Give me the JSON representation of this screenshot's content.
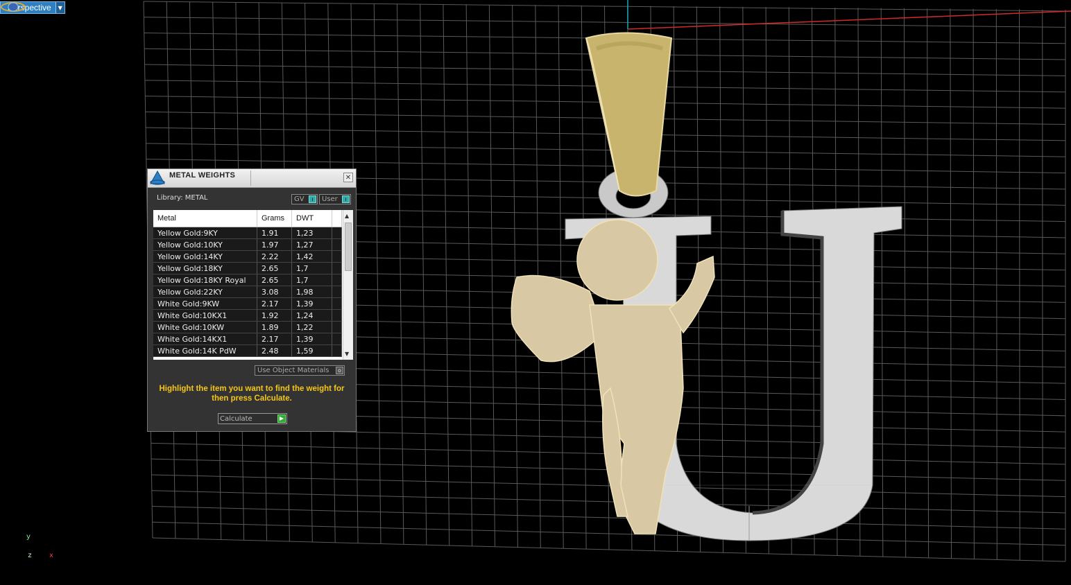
{
  "viewport": {
    "view_name": "Perspective",
    "axis_y": "y",
    "axis_z": "z",
    "axis_x": "x"
  },
  "panel": {
    "title": "METAL WEIGHTS",
    "library_label": "Library: METAL",
    "toggle_gv": "GV",
    "toggle_user": "User",
    "columns": [
      "Metal",
      "Grams",
      "DWT"
    ],
    "rows": [
      {
        "metal": "Yellow Gold:9KY",
        "grams": "1.91",
        "dwt": "1,23"
      },
      {
        "metal": "Yellow Gold:10KY",
        "grams": "1.97",
        "dwt": "1,27"
      },
      {
        "metal": "Yellow Gold:14KY",
        "grams": "2.22",
        "dwt": "1,42"
      },
      {
        "metal": "Yellow Gold:18KY",
        "grams": "2.65",
        "dwt": "1,7"
      },
      {
        "metal": "Yellow Gold:18KY Royal",
        "grams": "2.65",
        "dwt": "1,7"
      },
      {
        "metal": "Yellow Gold:22KY",
        "grams": "3.08",
        "dwt": "1,98"
      },
      {
        "metal": "White Gold:9KW",
        "grams": "2.17",
        "dwt": "1,39"
      },
      {
        "metal": "White Gold:10KX1",
        "grams": "1.92",
        "dwt": "1,24"
      },
      {
        "metal": "White Gold:10KW",
        "grams": "1.89",
        "dwt": "1,22"
      },
      {
        "metal": "White Gold:14KX1",
        "grams": "2.17",
        "dwt": "1,39"
      },
      {
        "metal": "White Gold:14K PdW",
        "grams": "2.48",
        "dwt": "1,59"
      }
    ],
    "use_object_materials": "Use Object Materials",
    "hint": "Highlight the item you want to find the weight for then press Calculate.",
    "calculate_label": "Calculate"
  },
  "colors": {
    "view_label_bg": "#2d7fc1",
    "hint_text": "#f5c518",
    "grid_line": "#5a5a5a",
    "gold_bail": "#c9b46e",
    "angel": "#d8c8a4",
    "letter_u": "#d9d9d9",
    "axis_red": "#d42a2a",
    "axis_cyan": "#1aa6b7"
  }
}
